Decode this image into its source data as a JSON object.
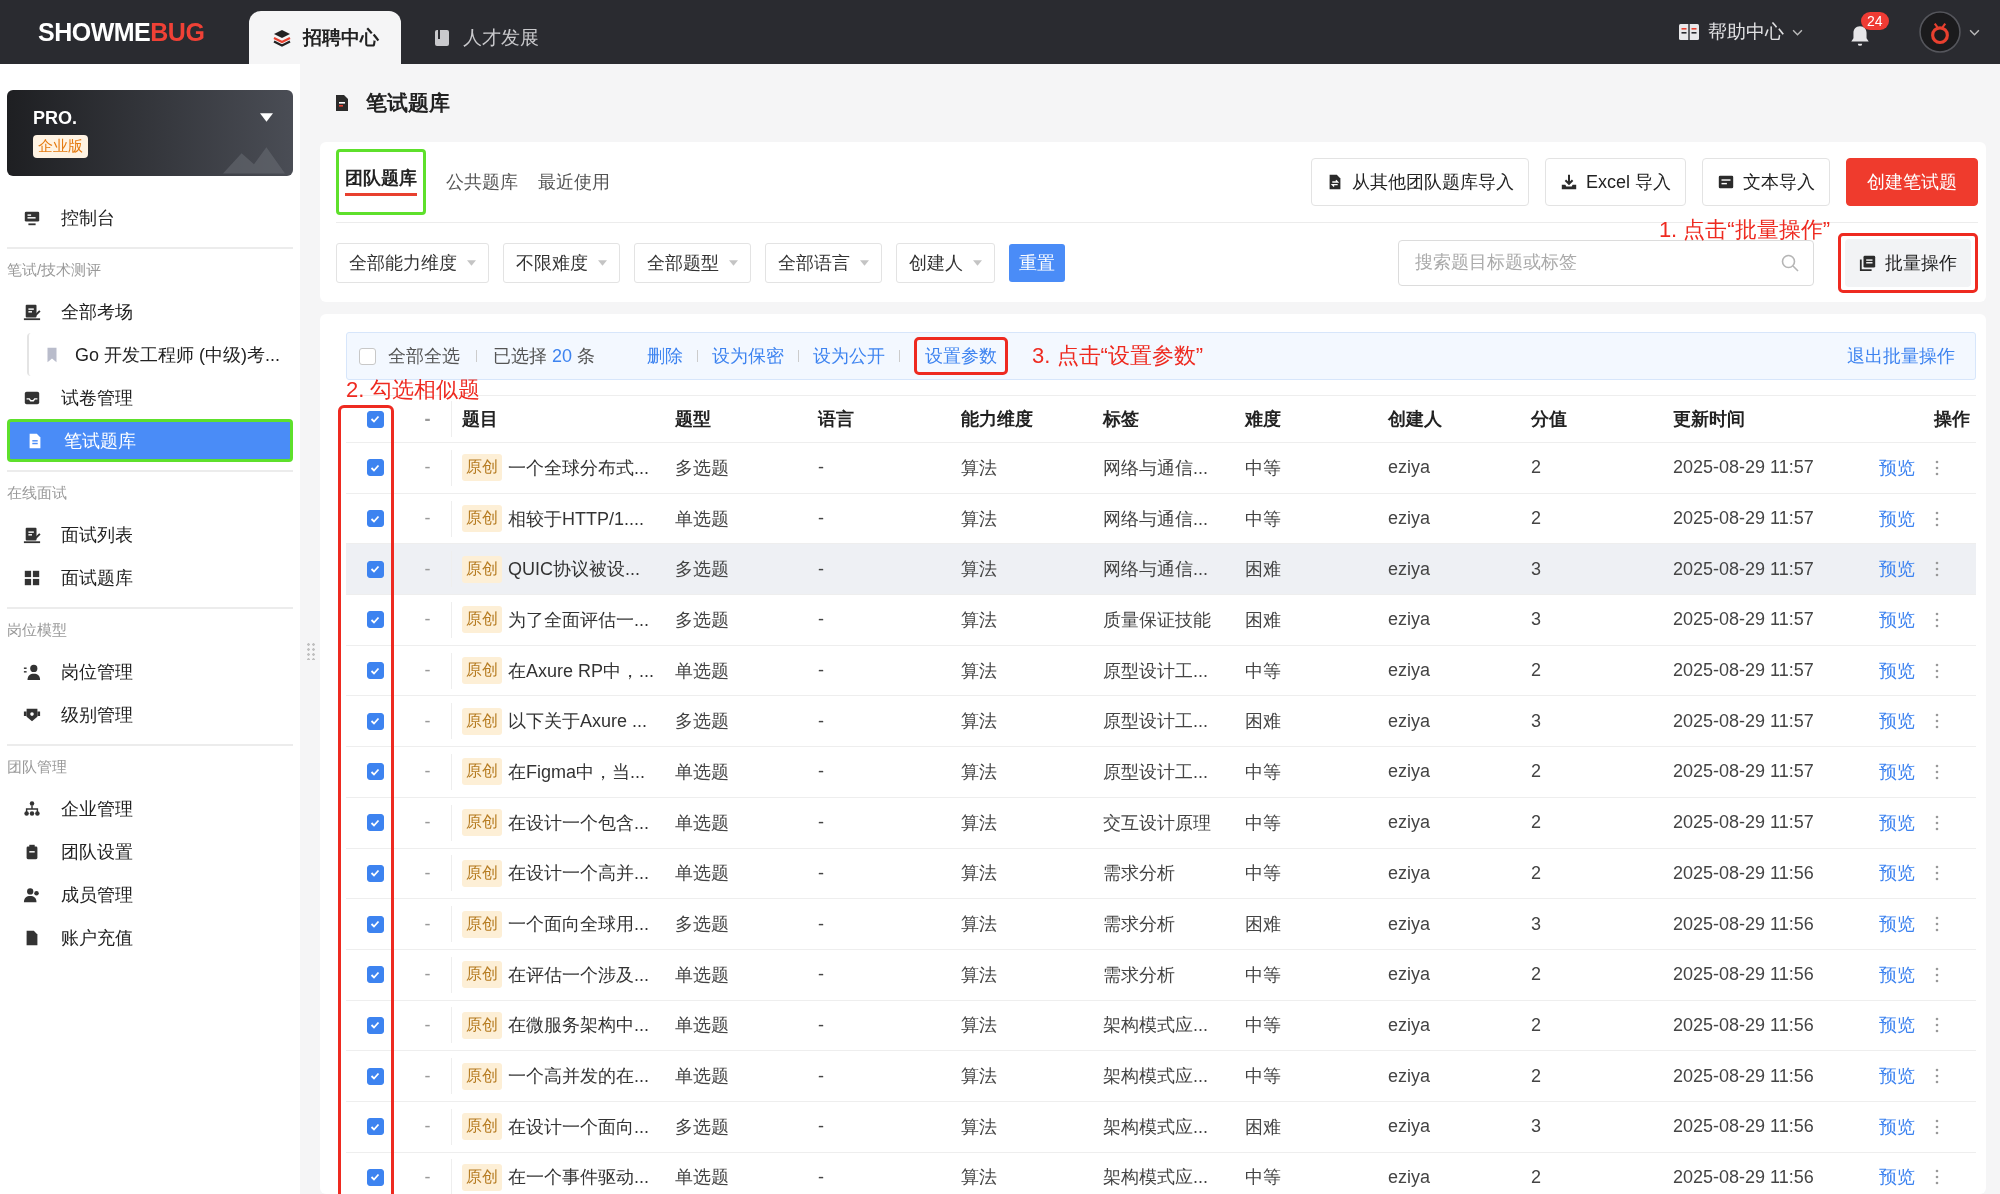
{
  "top_nav": {
    "logo": {
      "main": "SHOWME",
      "accent": "BUG"
    },
    "tabs": [
      {
        "label": "招聘中心",
        "selected": true
      },
      {
        "label": "人才发展",
        "selected": false
      }
    ],
    "help": "帮助中心",
    "notifications": {
      "badge": "24"
    }
  },
  "sidebar": {
    "plan": {
      "name": "PRO.",
      "edition": "企业版"
    },
    "items": [
      {
        "kind": "item",
        "label": "控制台",
        "selected": false,
        "framed": false
      },
      {
        "kind": "section",
        "label": "笔试/技术测评"
      },
      {
        "kind": "item",
        "label": "全部考场",
        "selected": false,
        "framed": false
      },
      {
        "kind": "subitem",
        "label": "Go 开发工程师 (中级)考...",
        "selected": false,
        "framed": false
      },
      {
        "kind": "item",
        "label": "试卷管理",
        "selected": false,
        "framed": false
      },
      {
        "kind": "item",
        "label": "笔试题库",
        "selected": true,
        "framed": true
      },
      {
        "kind": "section",
        "label": "在线面试"
      },
      {
        "kind": "item",
        "label": "面试列表",
        "selected": false,
        "framed": false
      },
      {
        "kind": "item",
        "label": "面试题库",
        "selected": false,
        "framed": false
      },
      {
        "kind": "section",
        "label": "岗位模型"
      },
      {
        "kind": "item",
        "label": "岗位管理",
        "selected": false,
        "framed": false
      },
      {
        "kind": "item",
        "label": "级别管理",
        "selected": false,
        "framed": false
      },
      {
        "kind": "section",
        "label": "团队管理"
      },
      {
        "kind": "item",
        "label": "企业管理",
        "selected": false,
        "framed": false
      },
      {
        "kind": "item",
        "label": "团队设置",
        "selected": false,
        "framed": false
      },
      {
        "kind": "item",
        "label": "成员管理",
        "selected": false,
        "framed": false
      },
      {
        "kind": "item",
        "label": "账户充值",
        "selected": false,
        "framed": false
      }
    ]
  },
  "page_title": "笔试题库",
  "library_tabs": [
    {
      "label": "团队题库",
      "selected": true,
      "framed": true
    },
    {
      "label": "公共题库",
      "selected": false,
      "framed": false
    },
    {
      "label": "最近使用",
      "selected": false,
      "framed": false
    }
  ],
  "import_buttons": [
    {
      "kind": "import",
      "label": "从其他团队题库导入"
    },
    {
      "kind": "import",
      "label": "Excel 导入"
    },
    {
      "kind": "import",
      "label": "文本导入"
    },
    {
      "kind": "primary",
      "label": "创建笔试题"
    }
  ],
  "filters": [
    "全部能力维度",
    "不限难度",
    "全部题型",
    "全部语言",
    "创建人"
  ],
  "reset_button": "重置",
  "search": {
    "placeholder": "搜索题目标题或标签"
  },
  "batch_button": {
    "label": "批量操作",
    "framed": true,
    "note": "1. 点击“批量操作”"
  },
  "batch_bar": {
    "select_all": {
      "label": "全部全选",
      "checked": false
    },
    "selected_prefix": "已选择",
    "selected_count": "20",
    "selected_suffix": "条",
    "actions": [
      {
        "label": "删除",
        "framed": false
      },
      {
        "label": "设为保密",
        "framed": false
      },
      {
        "label": "设为公开",
        "framed": false
      },
      {
        "label": "设置参数",
        "framed": true,
        "note": "3. 点击“设置参数”"
      }
    ],
    "exit": "退出批量操作"
  },
  "table": {
    "note": "2. 勾选相似题",
    "checkbox_column_framed": true,
    "header_checked": true,
    "header_column_2": "-",
    "columns": [
      "题目",
      "题型",
      "语言",
      "能力维度",
      "标签",
      "难度",
      "创建人",
      "分值",
      "更新时间",
      "操作"
    ],
    "rows": [
      {
        "checked": true,
        "hovered": false,
        "column_2": "-",
        "tag": "原创",
        "title": "一个全球分布式...",
        "type": "多选题",
        "language": "-",
        "ability": "算法",
        "label": "网络与通信...",
        "difficulty": "中等",
        "creator": "eziya",
        "score": "2",
        "updated": "2025-08-29 11:57",
        "action": "预览"
      },
      {
        "checked": true,
        "hovered": false,
        "column_2": "-",
        "tag": "原创",
        "title": "相较于HTTP/1....",
        "type": "单选题",
        "language": "-",
        "ability": "算法",
        "label": "网络与通信...",
        "difficulty": "中等",
        "creator": "eziya",
        "score": "2",
        "updated": "2025-08-29 11:57",
        "action": "预览"
      },
      {
        "checked": true,
        "hovered": true,
        "column_2": "-",
        "tag": "原创",
        "title": "QUIC协议被设...",
        "type": "多选题",
        "language": "-",
        "ability": "算法",
        "label": "网络与通信...",
        "difficulty": "困难",
        "creator": "eziya",
        "score": "3",
        "updated": "2025-08-29 11:57",
        "action": "预览"
      },
      {
        "checked": true,
        "hovered": false,
        "column_2": "-",
        "tag": "原创",
        "title": "为了全面评估一...",
        "type": "多选题",
        "language": "-",
        "ability": "算法",
        "label": "质量保证技能",
        "difficulty": "困难",
        "creator": "eziya",
        "score": "3",
        "updated": "2025-08-29 11:57",
        "action": "预览"
      },
      {
        "checked": true,
        "hovered": false,
        "column_2": "-",
        "tag": "原创",
        "title": "在Axure RP中，...",
        "type": "单选题",
        "language": "-",
        "ability": "算法",
        "label": "原型设计工...",
        "difficulty": "中等",
        "creator": "eziya",
        "score": "2",
        "updated": "2025-08-29 11:57",
        "action": "预览"
      },
      {
        "checked": true,
        "hovered": false,
        "column_2": "-",
        "tag": "原创",
        "title": "以下关于Axure ...",
        "type": "多选题",
        "language": "-",
        "ability": "算法",
        "label": "原型设计工...",
        "difficulty": "困难",
        "creator": "eziya",
        "score": "3",
        "updated": "2025-08-29 11:57",
        "action": "预览"
      },
      {
        "checked": true,
        "hovered": false,
        "column_2": "-",
        "tag": "原创",
        "title": "在Figma中，当...",
        "type": "单选题",
        "language": "-",
        "ability": "算法",
        "label": "原型设计工...",
        "difficulty": "中等",
        "creator": "eziya",
        "score": "2",
        "updated": "2025-08-29 11:57",
        "action": "预览"
      },
      {
        "checked": true,
        "hovered": false,
        "column_2": "-",
        "tag": "原创",
        "title": "在设计一个包含...",
        "type": "单选题",
        "language": "-",
        "ability": "算法",
        "label": "交互设计原理",
        "difficulty": "中等",
        "creator": "eziya",
        "score": "2",
        "updated": "2025-08-29 11:57",
        "action": "预览"
      },
      {
        "checked": true,
        "hovered": false,
        "column_2": "-",
        "tag": "原创",
        "title": "在设计一个高并...",
        "type": "单选题",
        "language": "-",
        "ability": "算法",
        "label": "需求分析",
        "difficulty": "中等",
        "creator": "eziya",
        "score": "2",
        "updated": "2025-08-29 11:56",
        "action": "预览"
      },
      {
        "checked": true,
        "hovered": false,
        "column_2": "-",
        "tag": "原创",
        "title": "一个面向全球用...",
        "type": "多选题",
        "language": "-",
        "ability": "算法",
        "label": "需求分析",
        "difficulty": "困难",
        "creator": "eziya",
        "score": "3",
        "updated": "2025-08-29 11:56",
        "action": "预览"
      },
      {
        "checked": true,
        "hovered": false,
        "column_2": "-",
        "tag": "原创",
        "title": "在评估一个涉及...",
        "type": "单选题",
        "language": "-",
        "ability": "算法",
        "label": "需求分析",
        "difficulty": "中等",
        "creator": "eziya",
        "score": "2",
        "updated": "2025-08-29 11:56",
        "action": "预览"
      },
      {
        "checked": true,
        "hovered": false,
        "column_2": "-",
        "tag": "原创",
        "title": "在微服务架构中...",
        "type": "单选题",
        "language": "-",
        "ability": "算法",
        "label": "架构模式应...",
        "difficulty": "中等",
        "creator": "eziya",
        "score": "2",
        "updated": "2025-08-29 11:56",
        "action": "预览"
      },
      {
        "checked": true,
        "hovered": false,
        "column_2": "-",
        "tag": "原创",
        "title": "一个高并发的在...",
        "type": "单选题",
        "language": "-",
        "ability": "算法",
        "label": "架构模式应...",
        "difficulty": "中等",
        "creator": "eziya",
        "score": "2",
        "updated": "2025-08-29 11:56",
        "action": "预览"
      },
      {
        "checked": true,
        "hovered": false,
        "column_2": "-",
        "tag": "原创",
        "title": "在设计一个面向...",
        "type": "多选题",
        "language": "-",
        "ability": "算法",
        "label": "架构模式应...",
        "difficulty": "困难",
        "creator": "eziya",
        "score": "3",
        "updated": "2025-08-29 11:56",
        "action": "预览"
      },
      {
        "checked": true,
        "hovered": false,
        "column_2": "-",
        "tag": "原创",
        "title": "在一个事件驱动...",
        "type": "单选题",
        "language": "-",
        "ability": "算法",
        "label": "架构模式应...",
        "difficulty": "中等",
        "creator": "eziya",
        "score": "2",
        "updated": "2025-08-29 11:56",
        "action": "预览"
      }
    ]
  }
}
